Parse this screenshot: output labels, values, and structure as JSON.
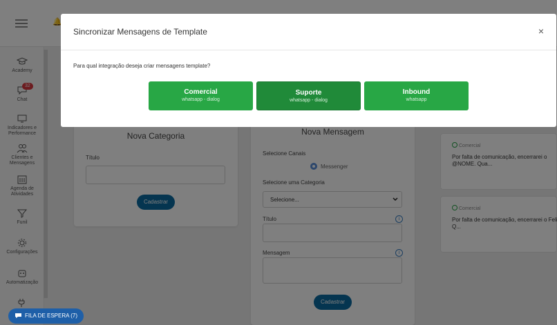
{
  "colors": {
    "green": "#28a745",
    "green_active": "#208a39",
    "primary": "#0b6aa0",
    "badge": "#d9363e",
    "whatsapp": "#25a244"
  },
  "sidebar": {
    "items": [
      {
        "label": "Academy",
        "icon": "graduation-cap-icon"
      },
      {
        "label": "Chat",
        "icon": "chat-icon",
        "badge": "32"
      },
      {
        "label": "Indicadores e Performance",
        "icon": "monitor-icon"
      },
      {
        "label": "Clientes e Mensagens",
        "icon": "users-icon"
      },
      {
        "label": "Agenda de Atividades",
        "icon": "calendar-icon"
      },
      {
        "label": "Funil",
        "icon": "funnel-icon"
      },
      {
        "label": "Configurações",
        "icon": "gear-icon"
      },
      {
        "label": "Automatização",
        "icon": "robot-icon"
      }
    ]
  },
  "categoria": {
    "title": "Nova Categoria",
    "titulo_label": "Título",
    "button": "Cadastrar"
  },
  "mensagem": {
    "title": "Nova Mensagem",
    "canais_label": "Selecione Canais",
    "canal_option": "Messenger",
    "categoria_label": "Selecione uma Categoria",
    "categoria_value": "Selecione...",
    "titulo_label": "Título",
    "mensagem_label": "Mensagem",
    "button": "Cadastrar"
  },
  "templates": [
    {
      "channel": "Comercial",
      "text": "Por falta de comunicação, encerrarei o @NOME. Qua..."
    },
    {
      "channel": "Comercial",
      "text": "Por falta de comunicação, encerrarei o Felinh Q..."
    }
  ],
  "fila": {
    "label": "FILA DE ESPERA (7)"
  },
  "modal": {
    "title": "Sincronizar Mensagens de Template",
    "question": "Para qual integração deseja criar mensagens template?",
    "options": [
      {
        "title": "Comercial",
        "subtitle": "whatsapp - dialog"
      },
      {
        "title": "Suporte",
        "subtitle": "whatsapp - dialog"
      },
      {
        "title": "Inbound",
        "subtitle": "whatsapp"
      }
    ]
  }
}
